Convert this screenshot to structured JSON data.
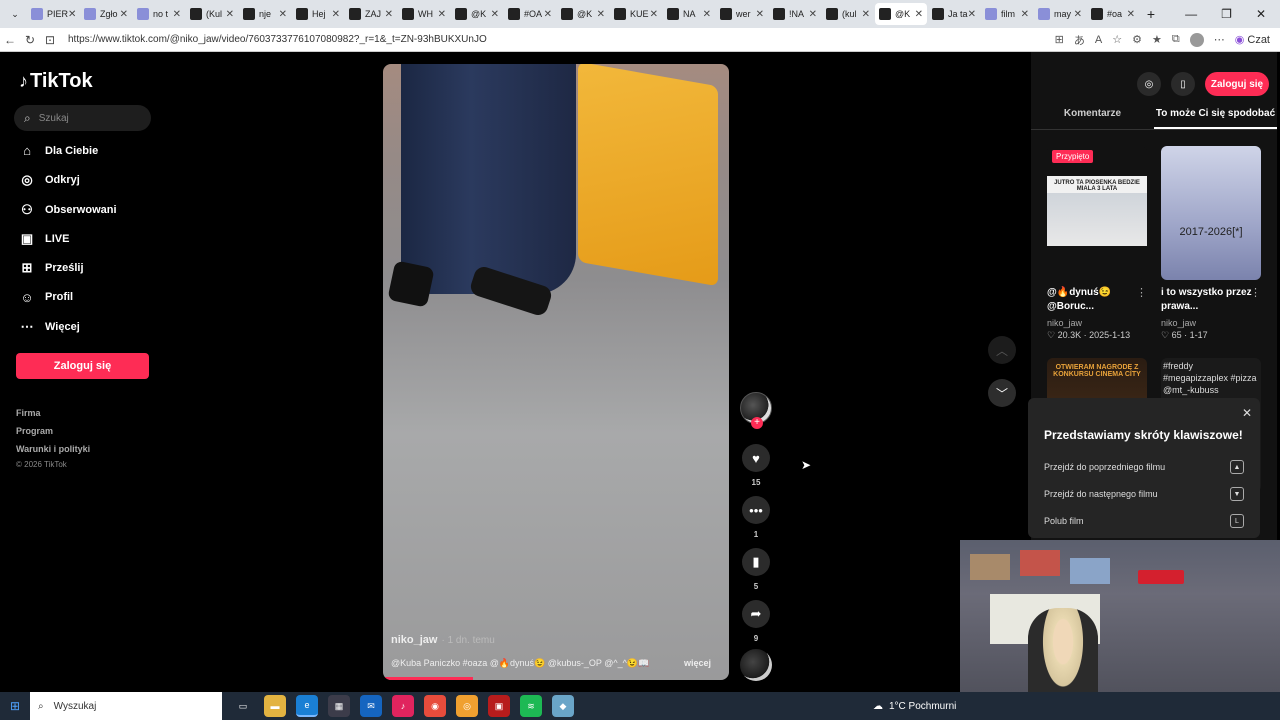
{
  "browser": {
    "tabs": [
      {
        "label": "PIER",
        "favicon": "page-icon"
      },
      {
        "label": "Zgło",
        "favicon": "page-icon"
      },
      {
        "label": "no t",
        "favicon": "page-icon"
      },
      {
        "label": "(Kul",
        "favicon": "tiktok-icon"
      },
      {
        "label": "nje",
        "favicon": "tiktok-icon"
      },
      {
        "label": "Hej",
        "favicon": "tiktok-icon"
      },
      {
        "label": "ZAJ",
        "favicon": "tiktok-icon"
      },
      {
        "label": "WH",
        "favicon": "tiktok-icon"
      },
      {
        "label": "@K",
        "favicon": "tiktok-icon"
      },
      {
        "label": "#OA",
        "favicon": "tiktok-icon"
      },
      {
        "label": "@K",
        "favicon": "tiktok-icon"
      },
      {
        "label": "KUE",
        "favicon": "tiktok-icon"
      },
      {
        "label": "NA",
        "favicon": "tiktok-icon"
      },
      {
        "label": "wer",
        "favicon": "tiktok-icon"
      },
      {
        "label": "!NA",
        "favicon": "tiktok-icon"
      },
      {
        "label": "(kul",
        "favicon": "tiktok-icon"
      },
      {
        "label": "@K",
        "favicon": "tiktok-icon"
      },
      {
        "label": "Ja ta",
        "favicon": "tiktok-icon"
      },
      {
        "label": "film",
        "favicon": "page-icon"
      },
      {
        "label": "may",
        "favicon": "page-icon"
      },
      {
        "label": "#oa",
        "favicon": "tiktok-icon"
      }
    ],
    "active_tab_index": 16,
    "url": "https://www.tiktok.com/@niko_jaw/video/7603733776107080982?_r=1&_t=ZN-93hBUKXUnJO",
    "profile_label": "Czat"
  },
  "sidebar": {
    "logo_text": "TikTok",
    "search_placeholder": "Szukaj",
    "nav": [
      {
        "label": "Dla Ciebie",
        "icon": "home-icon"
      },
      {
        "label": "Odkryj",
        "icon": "compass-icon"
      },
      {
        "label": "Obserwowani",
        "icon": "following-icon"
      },
      {
        "label": "LIVE",
        "icon": "live-icon"
      },
      {
        "label": "Prześlij",
        "icon": "upload-icon"
      },
      {
        "label": "Profil",
        "icon": "profile-icon"
      },
      {
        "label": "Więcej",
        "icon": "more-icon"
      }
    ],
    "login_button": "Zaloguj się",
    "footer_links": [
      "Firma",
      "Program",
      "Warunki i polityki"
    ],
    "copyright": "© 2026 TikTok"
  },
  "video": {
    "username": "niko_jaw",
    "age": "· 1 dn. temu",
    "description": "@Kuba Paniczko #oaza @🔥dynuś😉 @kubus-_OP @^_^😉📖",
    "more_label": "więcej",
    "progress": 0.26,
    "likes": "15",
    "comments": "1",
    "saves": "5",
    "shares": "9"
  },
  "right_panel": {
    "login_button": "Zaloguj się",
    "tabs": [
      "Komentarze",
      "To może Ci się spodobać"
    ],
    "active_tab": 1,
    "pinned_label": "Przypięto",
    "cards": [
      {
        "title": "@🔥dynuś😉 @Boruc...",
        "author": "niko_jaw",
        "likes": "20.3K",
        "date": "2025-1-13",
        "overlay": "JUTRO TA PIOSENKA BEDZIE MIALA 3 LATA"
      },
      {
        "title": "i to wszystko przez prawa...",
        "author": "niko_jaw",
        "likes": "65",
        "date": "1-17",
        "overlay": "2017-2026[*]"
      },
      {
        "title": "",
        "author": "",
        "likes": "",
        "date": "",
        "overlay": "OTWIERAM NAGRODĘ Z KONKURSU CINEMA CITY"
      },
      {
        "title": "",
        "author": "",
        "likes": "",
        "date": "",
        "overlay": "#freddy #megapizzaplex #pizza @mt_-kubuss"
      }
    ]
  },
  "shortcuts": {
    "title": "Przedstawiamy skróty klawiszowe!",
    "items": [
      {
        "label": "Przejdź do poprzedniego filmu",
        "key": "▲"
      },
      {
        "label": "Przejdź do następnego filmu",
        "key": "▼"
      },
      {
        "label": "Polub film",
        "key": "L"
      }
    ]
  },
  "taskbar": {
    "search_placeholder": "Wyszukaj",
    "weather": "1°C Pochmurni"
  }
}
